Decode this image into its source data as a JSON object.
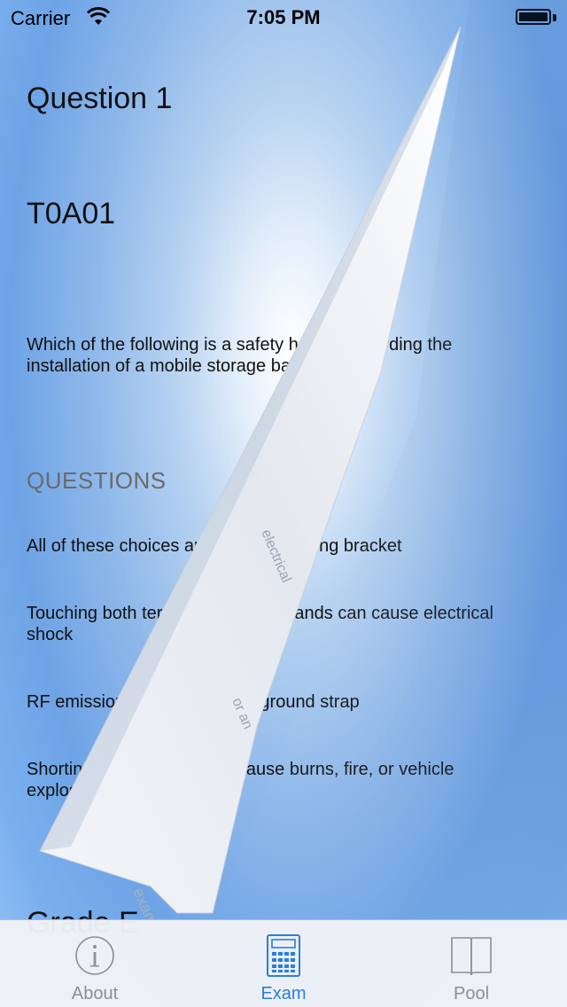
{
  "status_bar": {
    "carrier": "Carrier",
    "time": "7:05 PM"
  },
  "question": {
    "title": "Question 1",
    "code": "T0A01",
    "text": "Which of the following is a safety hazard regarding the installation of a mobile storage battery?"
  },
  "answers_section": {
    "header": "QUESTIONS",
    "answers": [
      "All of these choices are correct. Missing bracket",
      "Touching both terminals with the hands can cause electrical shock",
      "RF emissions from the check ground strap",
      "Shorting the terminals can cause burns, fire, or vehicle explosion"
    ]
  },
  "grade_peek": "Grade E",
  "page_curl_text": {
    "line1": "electrical",
    "line2": "or an",
    "line3": "exam"
  },
  "tab_bar": {
    "tabs": [
      {
        "label": "About",
        "icon": "info-icon",
        "selected": false
      },
      {
        "label": "Exam",
        "icon": "calculator-icon",
        "selected": true
      },
      {
        "label": "Pool",
        "icon": "book-icon",
        "selected": false
      }
    ]
  },
  "colors": {
    "accent": "#2a7ee0",
    "inactive_tab": "#8e8e93",
    "section_header": "#6a6a6a"
  }
}
